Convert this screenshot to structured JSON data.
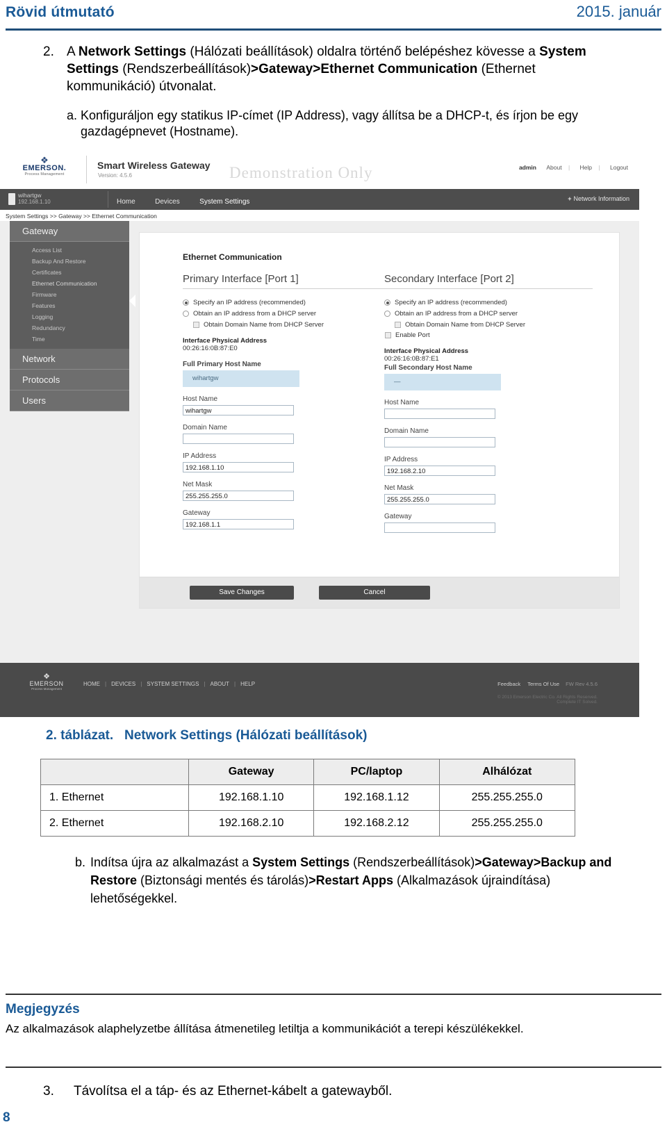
{
  "page_header": {
    "title": "Rövid útmutató",
    "date": "2015. január"
  },
  "step2": {
    "number": "2.",
    "text_parts": [
      {
        "t": "A ",
        "b": false
      },
      {
        "t": "Network Settings",
        "b": true
      },
      {
        "t": " (Hálózati beállítások) oldalra történő belépéshez kövesse a ",
        "b": false
      },
      {
        "t": "System Settings",
        "b": true
      },
      {
        "t": " (Rendszerbeállítások)",
        "b": false
      },
      {
        "t": ">Gateway>Ethernet Communication",
        "b": true
      },
      {
        "t": " (Ethernet kommunikáció) útvonalat.",
        "b": false
      }
    ],
    "sub_a": {
      "label": "a.",
      "text": "Konfiguráljon egy statikus IP-címet (IP Address), vagy állítsa be a DHCP-t, és írjon be egy gazdagépnevet (Hostname)."
    }
  },
  "screenshot": {
    "brand": {
      "logo_name": "EMERSON.",
      "logo_sub": "Process Management",
      "product": "Smart Wireless Gateway",
      "version": "Version: 4.5.6",
      "watermark": "Demonstration Only"
    },
    "account": {
      "user": "admin",
      "about": "About",
      "help": "Help",
      "logout": "Logout"
    },
    "nav": {
      "gateway_name": "wihartgw",
      "gateway_ip": "192.168.1.10",
      "items": [
        {
          "label": "Home",
          "active": false
        },
        {
          "label": "Devices",
          "active": false
        },
        {
          "label": "System Settings",
          "active": true
        }
      ],
      "network_information": "Network Information",
      "plus": "+"
    },
    "breadcrumb": "System Settings >> Gateway >> Ethernet Communication",
    "sidebar": {
      "sections": [
        {
          "label": "Gateway",
          "items": [
            {
              "label": "Access List",
              "active": false
            },
            {
              "label": "Backup And Restore",
              "active": false
            },
            {
              "label": "Certificates",
              "active": false
            },
            {
              "label": "Ethernet Communication",
              "active": true
            },
            {
              "label": "Firmware",
              "active": false
            },
            {
              "label": "Features",
              "active": false
            },
            {
              "label": "Logging",
              "active": false
            },
            {
              "label": "Redundancy",
              "active": false
            },
            {
              "label": "Time",
              "active": false
            }
          ]
        },
        {
          "label": "Network",
          "items": []
        },
        {
          "label": "Protocols",
          "items": []
        },
        {
          "label": "Users",
          "items": []
        }
      ]
    },
    "panel": {
      "heading": "Ethernet Communication",
      "primary": {
        "title": "Primary Interface [Port 1]",
        "radio_specify": "Specify an IP address (recommended)",
        "radio_dhcp": "Obtain an IP address from a DHCP server",
        "chk_domain": "Obtain Domain Name from DHCP Server",
        "selected": "specify",
        "mac_label": "Interface Physical Address",
        "mac_value": "00:26:16:0B:87:E0",
        "full_host_label": "Full Primary Host Name",
        "full_host_value": "wihartgw",
        "host_label": "Host Name",
        "host_value": "wihartgw",
        "domain_label": "Domain Name",
        "domain_value": "",
        "ip_label": "IP Address",
        "ip_value": "192.168.1.10",
        "mask_label": "Net Mask",
        "mask_value": "255.255.255.0",
        "gw_label": "Gateway",
        "gw_value": "192.168.1.1"
      },
      "secondary": {
        "title": "Secondary Interface [Port 2]",
        "radio_specify": "Specify an IP address (recommended)",
        "radio_dhcp": "Obtain an IP address from a DHCP server",
        "chk_domain": "Obtain Domain Name from DHCP Server",
        "chk_enable_port": "Enable Port",
        "selected": "specify",
        "mac_label": "Interface Physical Address",
        "mac_value": "00:26:16:0B:87:E1",
        "full_host_label": "Full Secondary Host Name",
        "full_host_value": "—",
        "host_label": "Host Name",
        "host_value": "",
        "domain_label": "Domain Name",
        "domain_value": "",
        "ip_label": "IP Address",
        "ip_value": "192.168.2.10",
        "mask_label": "Net Mask",
        "mask_value": "255.255.255.0",
        "gw_label": "Gateway",
        "gw_value": ""
      },
      "save_label": "Save Changes",
      "cancel_label": "Cancel"
    },
    "footer": {
      "logo_name": "EMERSON",
      "logo_sub": "Process Management",
      "nav": [
        "HOME",
        "DEVICES",
        "SYSTEM SETTINGS",
        "ABOUT",
        "HELP"
      ],
      "feedback": "Feedback",
      "terms": "Terms Of Use",
      "fw_rev": "FW Rev 4.5.6",
      "copyright": "© 2013 Emerson Electric Co. All Rights Reserved.",
      "copyright2": "Complete IT Solved."
    }
  },
  "table": {
    "caption_number": "2. táblázat.",
    "caption_text": "Network Settings (Hálózati beállítások)",
    "headers": [
      "",
      "Gateway",
      "PC/laptop",
      "Alhálózat"
    ],
    "rows": [
      [
        "1. Ethernet",
        "192.168.1.10",
        "192.168.1.12",
        "255.255.255.0"
      ],
      [
        "2. Ethernet",
        "192.168.2.10",
        "192.168.2.12",
        "255.255.255.0"
      ]
    ]
  },
  "sub_b": {
    "label": "b.",
    "parts": [
      {
        "t": "Indítsa újra az alkalmazást a ",
        "b": false
      },
      {
        "t": "System Settings",
        "b": true
      },
      {
        "t": " (Rendszerbeállítások)",
        "b": false
      },
      {
        "t": ">Gateway>Backup and Restore",
        "b": true
      },
      {
        "t": " (Biztonsági mentés és tárolás)",
        "b": false
      },
      {
        "t": ">Restart Apps",
        "b": true
      },
      {
        "t": " (Alkalmazások újraindítása) lehetőségekkel.",
        "b": false
      }
    ]
  },
  "note": {
    "title": "Megjegyzés",
    "body": "Az alkalmazások alaphelyzetbe állítása átmenetileg letiltja a kommunikációt a terepi készülékekkel."
  },
  "step3": {
    "number": "3.",
    "text": "Távolítsa el a táp- és az Ethernet-kábelt a gatewayből."
  },
  "page_number": "8"
}
